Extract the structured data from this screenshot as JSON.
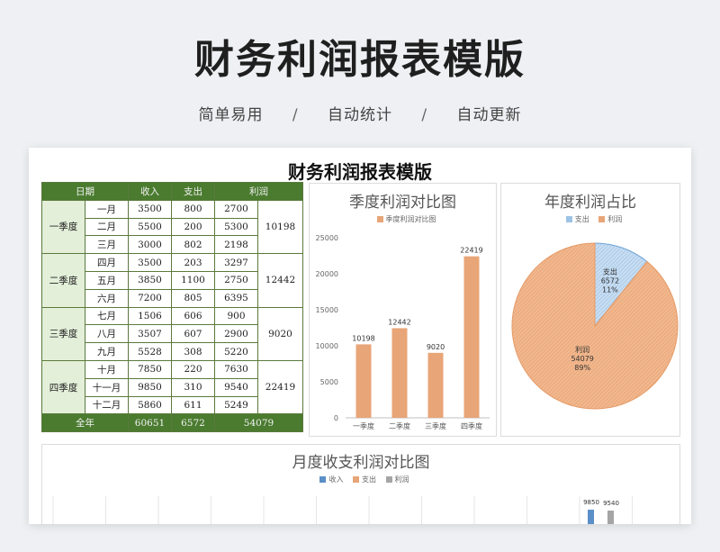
{
  "header": {
    "title": "财务利润报表模版",
    "tags": [
      "简单易用",
      "自动统计",
      "自动更新"
    ],
    "separator": "/"
  },
  "sheet": {
    "title": "财务利润报表模版",
    "table": {
      "headers": [
        "日期",
        "收入",
        "支出",
        "利润"
      ],
      "quarters": [
        {
          "name": "一季度",
          "total": "10198",
          "months": [
            {
              "month": "一月",
              "income": "3500",
              "expense": "800",
              "profit": "2700"
            },
            {
              "month": "二月",
              "income": "5500",
              "expense": "200",
              "profit": "5300"
            },
            {
              "month": "三月",
              "income": "3000",
              "expense": "802",
              "profit": "2198"
            }
          ]
        },
        {
          "name": "二季度",
          "total": "12442",
          "months": [
            {
              "month": "四月",
              "income": "3500",
              "expense": "203",
              "profit": "3297"
            },
            {
              "month": "五月",
              "income": "3850",
              "expense": "1100",
              "profit": "2750"
            },
            {
              "month": "六月",
              "income": "7200",
              "expense": "805",
              "profit": "6395"
            }
          ]
        },
        {
          "name": "三季度",
          "total": "9020",
          "months": [
            {
              "month": "七月",
              "income": "1506",
              "expense": "606",
              "profit": "900"
            },
            {
              "month": "八月",
              "income": "3507",
              "expense": "607",
              "profit": "2900"
            },
            {
              "month": "九月",
              "income": "5528",
              "expense": "308",
              "profit": "5220"
            }
          ]
        },
        {
          "name": "四季度",
          "total": "22419",
          "months": [
            {
              "month": "十月",
              "income": "7850",
              "expense": "220",
              "profit": "7630"
            },
            {
              "month": "十一月",
              "income": "9850",
              "expense": "310",
              "profit": "9540"
            },
            {
              "month": "十二月",
              "income": "5860",
              "expense": "611",
              "profit": "5249"
            }
          ]
        }
      ],
      "footer": {
        "label": "全年",
        "income": "60651",
        "expense": "6572",
        "profit": "54079"
      }
    }
  },
  "colors": {
    "header_green": "#4a7b2f",
    "light_green": "#e3efd9",
    "orange": "#e8a577",
    "blue": "#9dc3e6",
    "gray": "#a5a5a5"
  },
  "chart_data": [
    {
      "type": "bar",
      "title": "季度利润对比图",
      "legend": [
        "季度利润对比图"
      ],
      "categories": [
        "一季度",
        "二季度",
        "三季度",
        "四季度"
      ],
      "values": [
        10198,
        12442,
        9020,
        22419
      ],
      "ylim": [
        0,
        25000
      ],
      "yticks": [
        0,
        5000,
        10000,
        15000,
        20000,
        25000
      ],
      "color": "#e8a577"
    },
    {
      "type": "pie",
      "title": "年度利润占比",
      "legend": [
        "支出",
        "利润"
      ],
      "slices": [
        {
          "name": "支出",
          "value": 6572,
          "percent": "11%",
          "color": "#9dc3e6"
        },
        {
          "name": "利润",
          "value": 54079,
          "percent": "89%",
          "color": "#e8a577"
        }
      ]
    },
    {
      "type": "bar",
      "title": "月度收支利润对比图",
      "legend": [
        "收入",
        "支出",
        "利润"
      ],
      "visible_labels": [
        "9850",
        "9540"
      ],
      "colors": [
        "#5b8fc7",
        "#e8a577",
        "#a5a5a5"
      ]
    }
  ]
}
